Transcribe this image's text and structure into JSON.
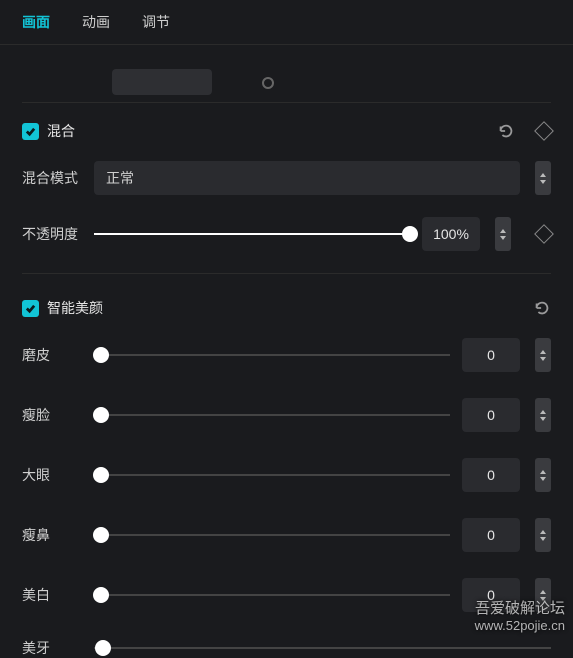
{
  "tabs": {
    "picture": "画面",
    "animation": "动画",
    "adjust": "调节",
    "active": 0
  },
  "blend": {
    "title": "混合",
    "mode_label": "混合模式",
    "mode_value": "正常",
    "opacity_label": "不透明度",
    "opacity_value": "100%",
    "opacity_pct": 100
  },
  "beauty": {
    "title": "智能美颜",
    "params": [
      {
        "label": "磨皮",
        "value": "0",
        "pct": 2
      },
      {
        "label": "瘦脸",
        "value": "0",
        "pct": 0
      },
      {
        "label": "大眼",
        "value": "0",
        "pct": 0
      },
      {
        "label": "瘦鼻",
        "value": "0",
        "pct": 0
      },
      {
        "label": "美白",
        "value": "0",
        "pct": 0
      },
      {
        "label": "美牙",
        "value": "",
        "pct": 0,
        "no_value": true
      }
    ]
  },
  "watermark": {
    "line1": "吾爱破解论坛",
    "line2": "www.52pojie.cn"
  }
}
